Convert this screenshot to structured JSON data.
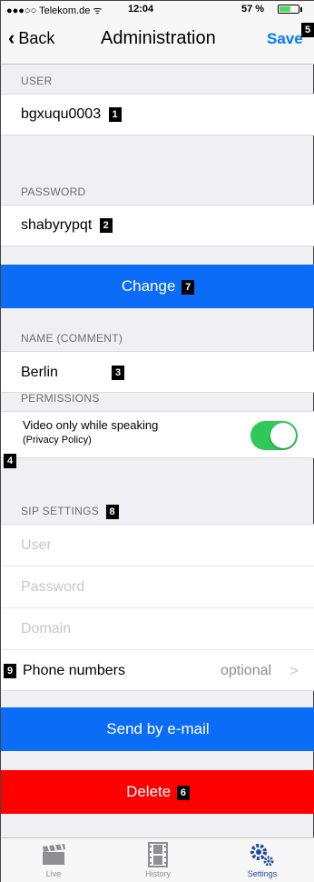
{
  "status_bar": {
    "carrier": "●●●○○ Telekom.de ᯤ",
    "time": "12:04",
    "battery": "57 %"
  },
  "nav": {
    "back_label": "Back",
    "title": "Administration",
    "save_label": "Save"
  },
  "badges": {
    "user": "1",
    "password": "2",
    "name": "3",
    "permissions": "4",
    "save": "5",
    "delete": "6",
    "change": "7",
    "sip": "8",
    "phone": "9"
  },
  "user": {
    "label": "USER",
    "value": "bgxuqu0003"
  },
  "password": {
    "label": "PASSWORD",
    "value": "shabyrypqt"
  },
  "change_label": "Change",
  "name": {
    "label": "NAME (COMMENT)",
    "value": "Berlin"
  },
  "permissions": {
    "label": "PERMISSIONS",
    "video_title": "Video only while speaking",
    "video_sub": "(Privacy Policy)",
    "video_enabled": true
  },
  "sip": {
    "label": "SIP SETTINGS",
    "user_placeholder": "User",
    "password_placeholder": "Password",
    "domain_placeholder": "Domain"
  },
  "phone": {
    "label": "Phone numbers",
    "value": "optional",
    "chevron": ">"
  },
  "send_label": "Send by e-mail",
  "delete_label": "Delete",
  "tabs": [
    {
      "label": "Live",
      "icon": "clapperboard-icon"
    },
    {
      "label": "History",
      "icon": "film-icon"
    },
    {
      "label": "Settings",
      "icon": "gears-icon"
    }
  ],
  "colors": {
    "accent": "#007aff",
    "button_blue": "#0a6cf7",
    "delete_red": "#ff0000",
    "toggle_on": "#30c85a",
    "tab_active": "#1f4a9b"
  }
}
